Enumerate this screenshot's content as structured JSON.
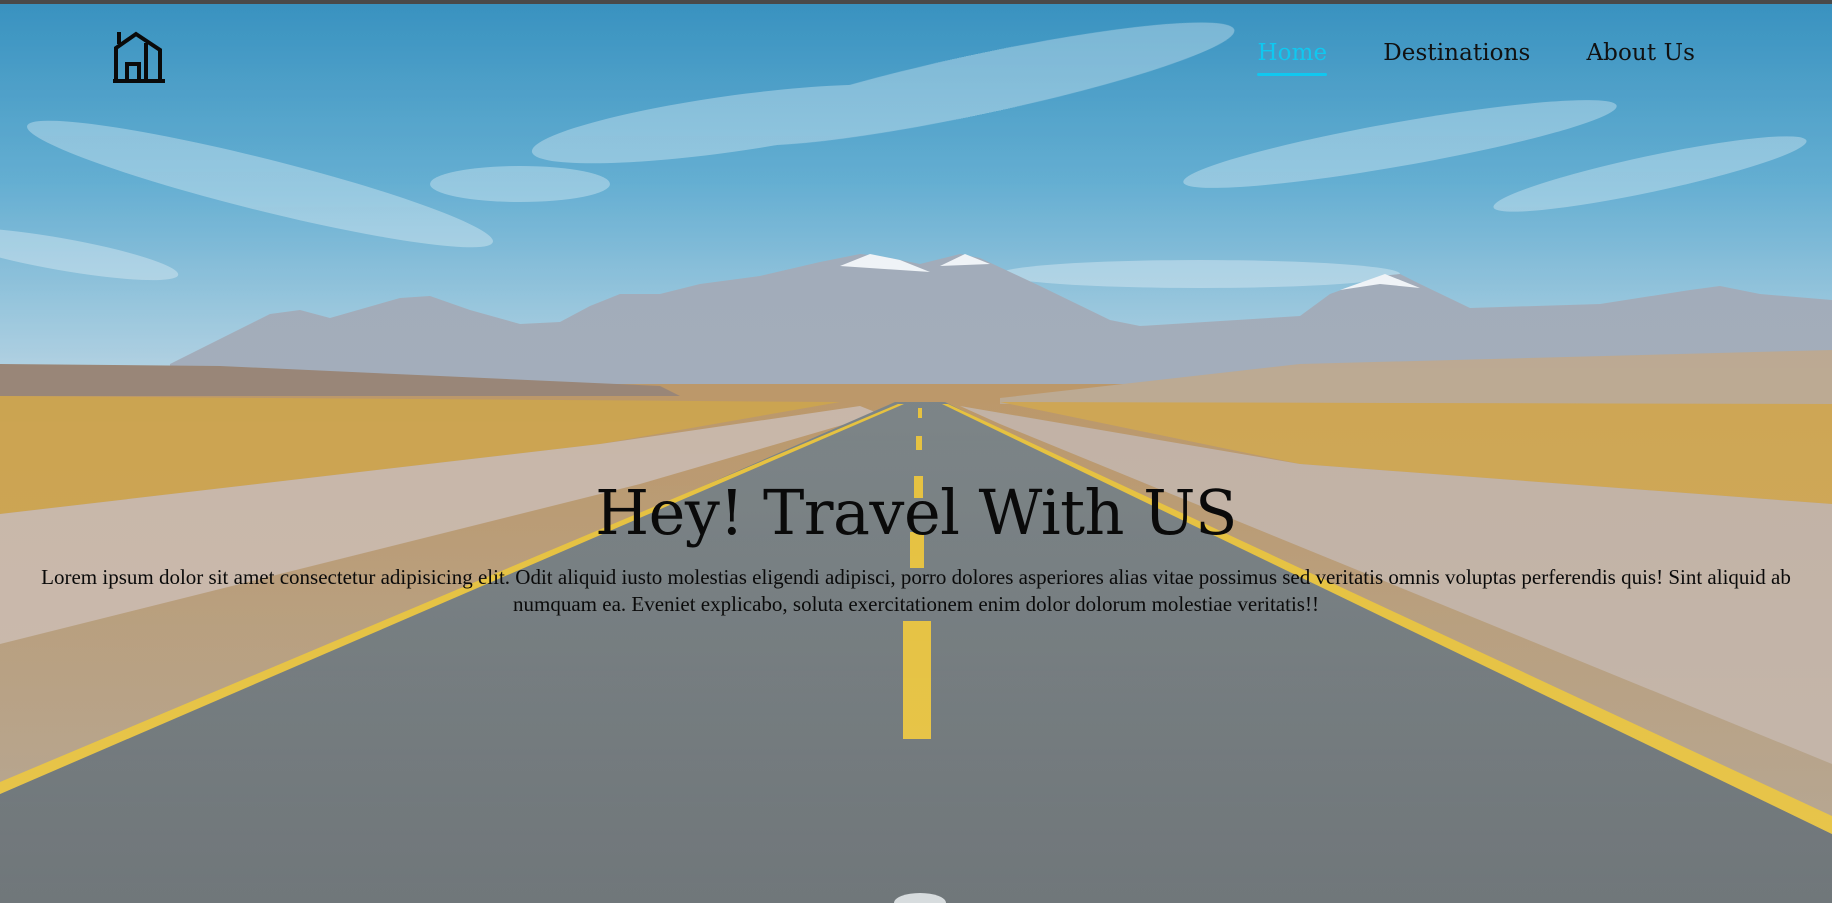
{
  "brand": {
    "logo_icon": "house-icon"
  },
  "nav": {
    "items": [
      {
        "label": "Home",
        "active": true
      },
      {
        "label": "Destinations",
        "active": false
      },
      {
        "label": "About Us",
        "active": false
      }
    ],
    "active_color": "#10c8f0"
  },
  "hero": {
    "title": "Hey! Travel With US",
    "description": "Lorem ipsum dolor sit amet consectetur adipisicing elit. Odit aliquid iusto molestias eligendi adipisci, porro dolores asperiores alias vitae possimus sed veritatis omnis voluptas perferendis quis! Sint aliquid ab numquam ea. Eveniet explicabo, soluta exercitationem enim dolor dolorum molestiae veritatis!!"
  },
  "colors": {
    "sky_top": "#2f8fbf",
    "sky_horizon": "#b6d3e3",
    "grass": "#c9a043",
    "road": "#5f6b70",
    "road_line": "#e8c02f"
  }
}
